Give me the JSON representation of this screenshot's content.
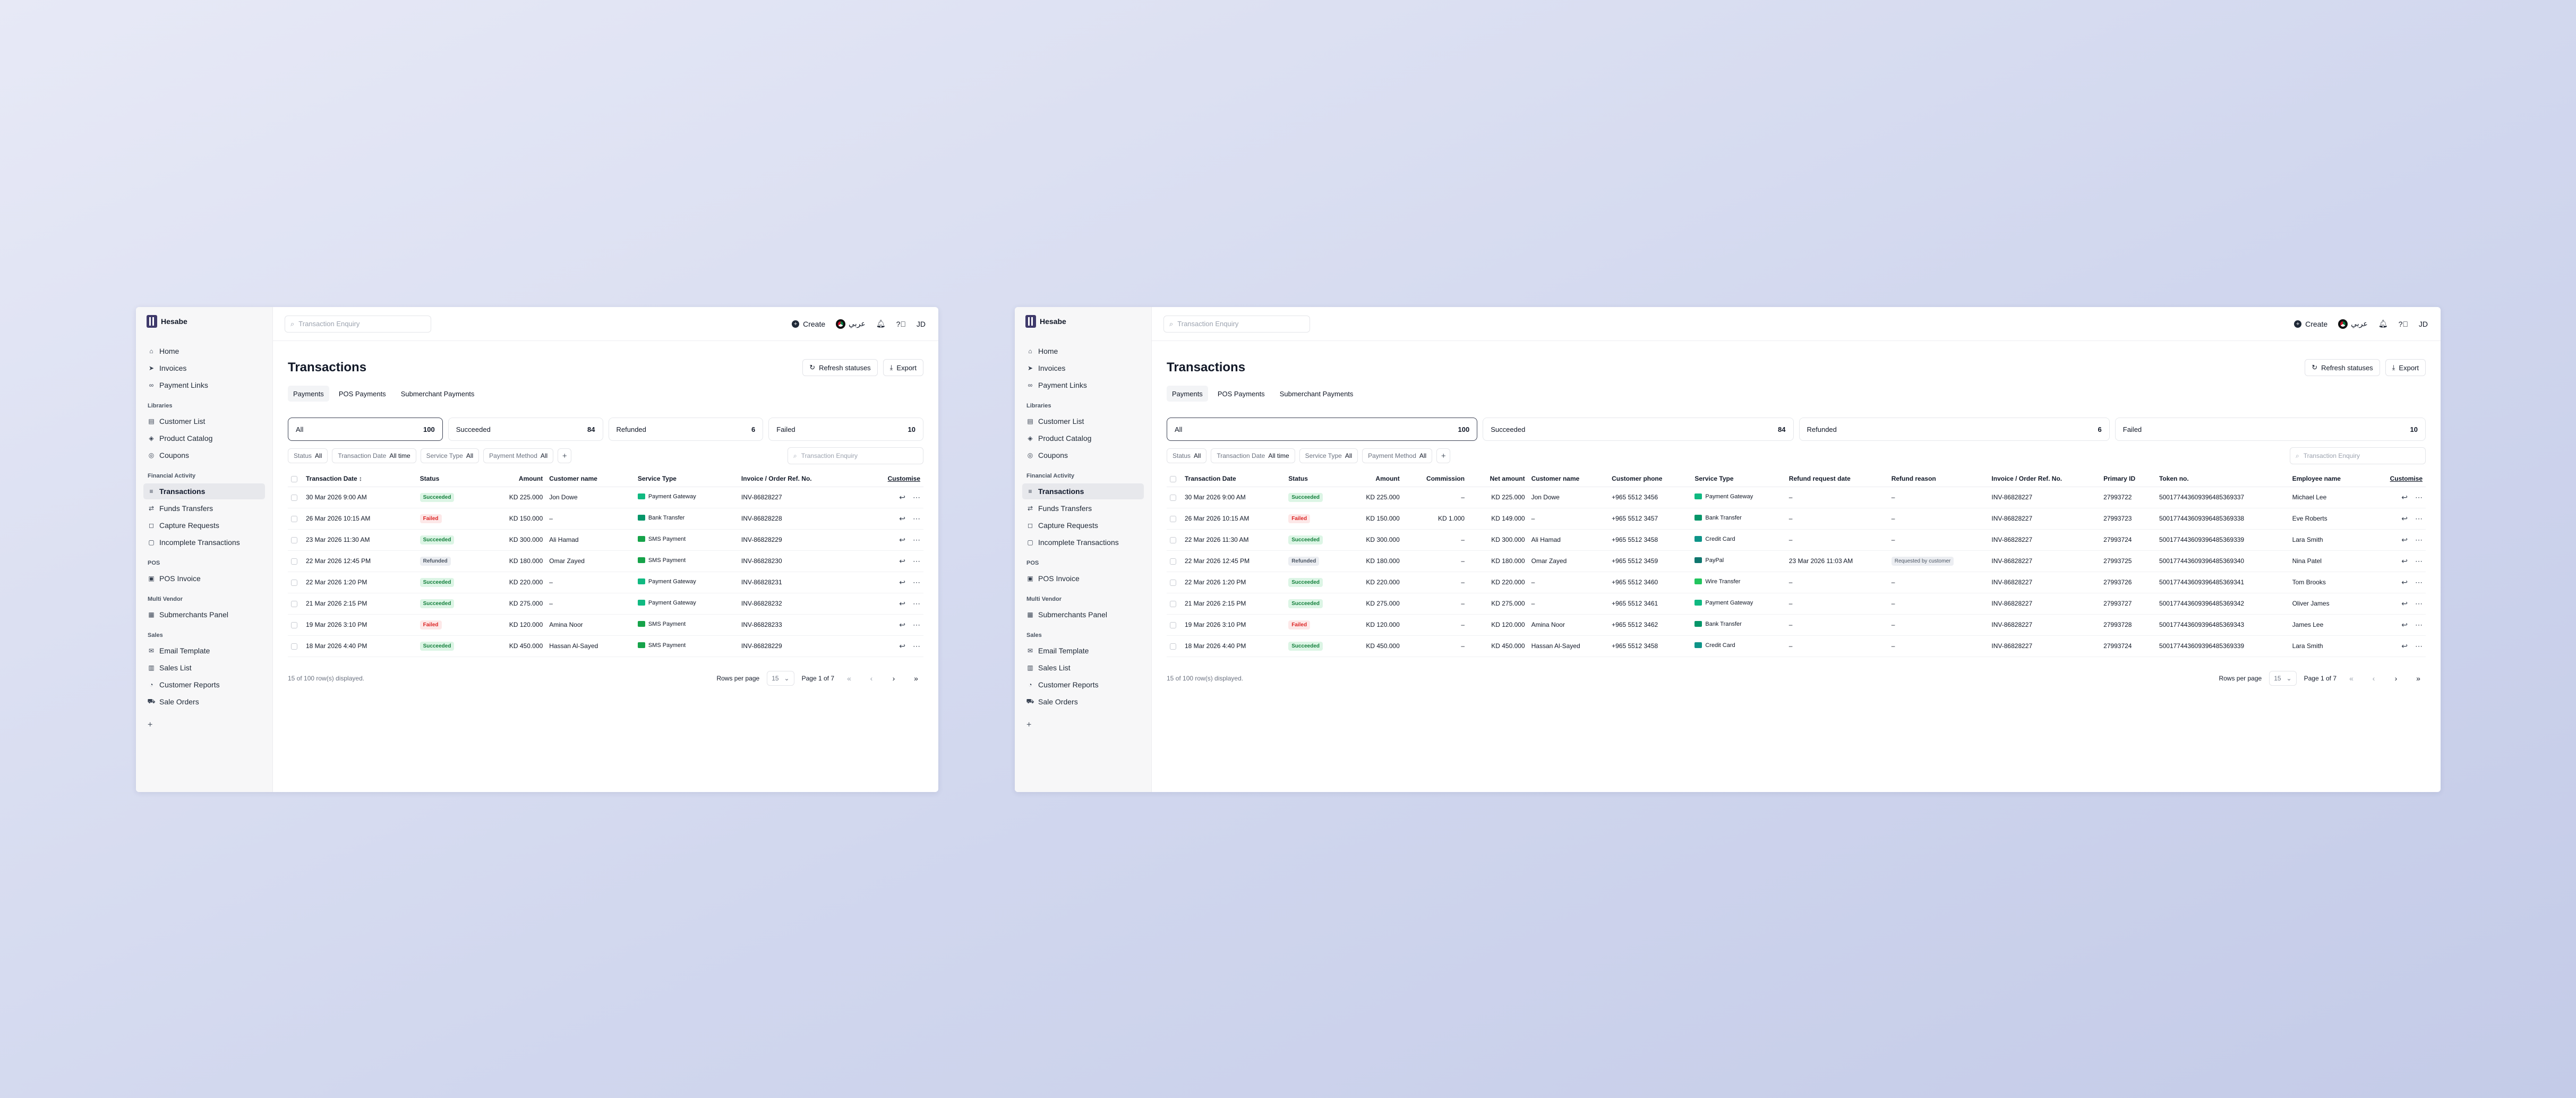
{
  "app": {
    "name": "Hesabe"
  },
  "sidebar": {
    "top_items": [
      {
        "label": "Home",
        "icon": "home-icon"
      },
      {
        "label": "Invoices",
        "icon": "send-icon"
      },
      {
        "label": "Payment Links",
        "icon": "link-icon"
      }
    ],
    "sections": [
      {
        "label": "Libraries",
        "items": [
          {
            "label": "Customer List",
            "icon": "contacts-icon"
          },
          {
            "label": "Product Catalog",
            "icon": "catalog-icon"
          },
          {
            "label": "Coupons",
            "icon": "coupon-icon"
          }
        ]
      },
      {
        "label": "Financial Activity",
        "items": [
          {
            "label": "Transactions",
            "icon": "transactions-icon",
            "active": true
          },
          {
            "label": "Funds Transfers",
            "icon": "transfer-icon"
          },
          {
            "label": "Capture Requests",
            "icon": "capture-icon"
          },
          {
            "label": "Incomplete Transactions",
            "icon": "incomplete-icon"
          }
        ]
      },
      {
        "label": "POS",
        "items": [
          {
            "label": "POS Invoice",
            "icon": "pos-icon"
          }
        ]
      },
      {
        "label": "Multi Vendor",
        "items": [
          {
            "label": "Submerchants Panel",
            "icon": "panel-icon"
          }
        ]
      },
      {
        "label": "Sales",
        "items": [
          {
            "label": "Email Template",
            "icon": "mail-icon"
          },
          {
            "label": "Sales List",
            "icon": "list-icon"
          },
          {
            "label": "Customer Reports",
            "icon": "report-icon"
          },
          {
            "label": "Sale Orders",
            "icon": "cart-icon"
          }
        ]
      }
    ]
  },
  "topbar": {
    "search_placeholder": "Transaction Enquiry",
    "create_label": "Create",
    "language_label": "عربي",
    "avatar_initials": "JD"
  },
  "page": {
    "title": "Transactions",
    "refresh_label": "Refresh statuses",
    "export_label": "Export"
  },
  "tabs": [
    "Payments",
    "POS Payments",
    "Submerchant Payments"
  ],
  "summary_cards": [
    {
      "label": "All",
      "count": "100"
    },
    {
      "label": "Succeeded",
      "count": "84"
    },
    {
      "label": "Refunded",
      "count": "6"
    },
    {
      "label": "Failed",
      "count": "10"
    }
  ],
  "filters": [
    {
      "name": "Status",
      "value": "All"
    },
    {
      "name": "Transaction Date",
      "value": "All time"
    },
    {
      "name": "Service Type",
      "value": "All"
    },
    {
      "name": "Payment Method",
      "value": "All"
    }
  ],
  "table_search_placeholder": "Transaction Enquiry",
  "customise_label": "Customise",
  "table1_headers": [
    "Transaction Date",
    "Status",
    "Amount",
    "Customer name",
    "Service Type",
    "Invoice / Order Ref. No."
  ],
  "table1_rows": [
    {
      "date": "30 Mar 2026 9:00 AM",
      "status": "Succeeded",
      "amount": "KD 225.000",
      "customer": "Jon Dowe",
      "service": "Payment Gateway",
      "invoice": "INV-86828227"
    },
    {
      "date": "26 Mar 2026 10:15 AM",
      "status": "Failed",
      "amount": "KD 150.000",
      "customer": "–",
      "service": "Bank Transfer",
      "invoice": "INV-86828228"
    },
    {
      "date": "23 Mar 2026 11:30 AM",
      "status": "Succeeded",
      "amount": "KD 300.000",
      "customer": "Ali Hamad",
      "service": "SMS Payment",
      "invoice": "INV-86828229"
    },
    {
      "date": "22 Mar 2026 12:45 PM",
      "status": "Refunded",
      "amount": "KD 180.000",
      "customer": "Omar Zayed",
      "service": "SMS Payment",
      "invoice": "INV-86828230"
    },
    {
      "date": "22 Mar 2026 1:20 PM",
      "status": "Succeeded",
      "amount": "KD 220.000",
      "customer": "–",
      "service": "Payment Gateway",
      "invoice": "INV-86828231"
    },
    {
      "date": "21 Mar 2026 2:15 PM",
      "status": "Succeeded",
      "amount": "KD 275.000",
      "customer": "–",
      "service": "Payment Gateway",
      "invoice": "INV-86828232"
    },
    {
      "date": "19 Mar 2026 3:10 PM",
      "status": "Failed",
      "amount": "KD 120.000",
      "customer": "Amina Noor",
      "service": "SMS Payment",
      "invoice": "INV-86828233"
    },
    {
      "date": "18 Mar 2026 4:40 PM",
      "status": "Succeeded",
      "amount": "KD 450.000",
      "customer": "Hassan Al-Sayed",
      "service": "SMS Payment",
      "invoice": "INV-86828229"
    }
  ],
  "table2_headers": [
    "Transaction Date",
    "Status",
    "Amount",
    "Commission",
    "Net amount",
    "Customer name",
    "Customer phone",
    "Service Type",
    "Refund request date",
    "Refund reason",
    "Invoice / Order Ref. No.",
    "Primary ID",
    "Token no.",
    "Employee name"
  ],
  "table2_rows": [
    {
      "date": "30 Mar 2026 9:00 AM",
      "status": "Succeeded",
      "amount": "KD 225.000",
      "commission": "–",
      "net": "KD 225.000",
      "customer": "Jon Dowe",
      "phone": "+965 5512 3456",
      "service": "Payment Gateway",
      "refund_date": "–",
      "refund_reason": "–",
      "invoice": "INV-86828227",
      "primary_id": "27993722",
      "token": "500177443609396485369337",
      "employee": "Michael Lee"
    },
    {
      "date": "26 Mar 2026 10:15 AM",
      "status": "Failed",
      "amount": "KD 150.000",
      "commission": "KD 1.000",
      "net": "KD 149.000",
      "customer": "–",
      "phone": "+965 5512 3457",
      "service": "Bank Transfer",
      "refund_date": "–",
      "refund_reason": "–",
      "invoice": "INV-86828227",
      "primary_id": "27993723",
      "token": "500177443609396485369338",
      "employee": "Eve Roberts"
    },
    {
      "date": "22 Mar 2026 11:30 AM",
      "status": "Succeeded",
      "amount": "KD 300.000",
      "commission": "–",
      "net": "KD 300.000",
      "customer": "Ali Hamad",
      "phone": "+965 5512 3458",
      "service": "Credit Card",
      "refund_date": "–",
      "refund_reason": "–",
      "invoice": "INV-86828227",
      "primary_id": "27993724",
      "token": "500177443609396485369339",
      "employee": "Lara Smith"
    },
    {
      "date": "22 Mar 2026 12:45 PM",
      "status": "Refunded",
      "amount": "KD 180.000",
      "commission": "–",
      "net": "KD 180.000",
      "customer": "Omar Zayed",
      "phone": "+965 5512 3459",
      "service": "PayPal",
      "refund_date": "23 Mar 2026 11:03 AM",
      "refund_reason": "Requested by customer",
      "invoice": "INV-86828227",
      "primary_id": "27993725",
      "token": "500177443609396485369340",
      "employee": "Nina Patel"
    },
    {
      "date": "22 Mar 2026 1:20 PM",
      "status": "Succeeded",
      "amount": "KD 220.000",
      "commission": "–",
      "net": "KD 220.000",
      "customer": "–",
      "phone": "+965 5512 3460",
      "service": "Wire Transfer",
      "refund_date": "–",
      "refund_reason": "–",
      "invoice": "INV-86828227",
      "primary_id": "27993726",
      "token": "500177443609396485369341",
      "employee": "Tom Brooks"
    },
    {
      "date": "21 Mar 2026 2:15 PM",
      "status": "Succeeded",
      "amount": "KD 275.000",
      "commission": "–",
      "net": "KD 275.000",
      "customer": "–",
      "phone": "+965 5512 3461",
      "service": "Payment Gateway",
      "refund_date": "–",
      "refund_reason": "–",
      "invoice": "INV-86828227",
      "primary_id": "27993727",
      "token": "500177443609396485369342",
      "employee": "Oliver James"
    },
    {
      "date": "19 Mar 2026 3:10 PM",
      "status": "Failed",
      "amount": "KD 120.000",
      "commission": "–",
      "net": "KD 120.000",
      "customer": "Amina Noor",
      "phone": "+965 5512 3462",
      "service": "Bank Transfer",
      "refund_date": "–",
      "refund_reason": "–",
      "invoice": "INV-86828227",
      "primary_id": "27993728",
      "token": "500177443609396485369343",
      "employee": "James Lee"
    },
    {
      "date": "18 Mar 2026 4:40 PM",
      "status": "Succeeded",
      "amount": "KD 450.000",
      "commission": "–",
      "net": "KD 450.000",
      "customer": "Hassan Al-Sayed",
      "phone": "+965 5512 3458",
      "service": "Credit Card",
      "refund_date": "–",
      "refund_reason": "–",
      "invoice": "INV-86828227",
      "primary_id": "27993724",
      "token": "500177443609396485369339",
      "employee": "Lara Smith"
    }
  ],
  "footer": {
    "rows_text": "15 of 100 row(s) displayed.",
    "rows_per_page_label": "Rows per page",
    "rows_per_page_value": "15",
    "page_text": "Page 1 of 7"
  },
  "colors": {
    "brand": "#3f3a6b",
    "succeeded": "#15803d",
    "failed": "#dc2626",
    "refunded": "#4b5563"
  }
}
